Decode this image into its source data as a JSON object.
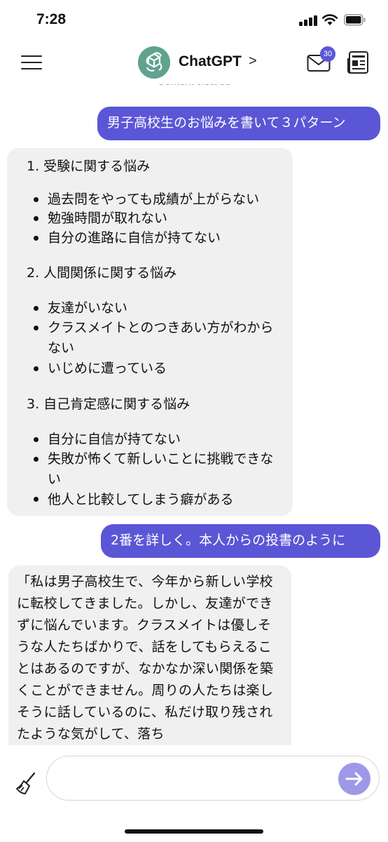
{
  "status": {
    "time": "7:28"
  },
  "header": {
    "title": "ChatGPT",
    "chevron": ">",
    "mail_badge": "30",
    "context_note": "Context cleared"
  },
  "messages": [
    {
      "role": "user",
      "text": "男子高校生のお悩みを書いて３パターン"
    },
    {
      "role": "assistant",
      "sections": [
        {
          "title": "1.  受験に関する悩み",
          "items": [
            "過去問をやっても成績が上がらない",
            "勉強時間が取れない",
            "自分の進路に自信が持てない"
          ]
        },
        {
          "title": "2.  人間関係に関する悩み",
          "items": [
            "友達がいない",
            "クラスメイトとのつきあい方がわからない",
            "いじめに遭っている"
          ]
        },
        {
          "title": "3.  自己肯定感に関する悩み",
          "items": [
            "自分に自信が持てない",
            "失敗が怖くて新しいことに挑戦できない",
            "他人と比較してしまう癖がある"
          ]
        }
      ]
    },
    {
      "role": "user",
      "text": "2番を詳しく。本人からの投書のように"
    },
    {
      "role": "assistant",
      "text": "「私は男子高校生で、今年から新しい学校に転校してきました。しかし、友達ができずに悩んでいます。クラスメイトは優しそうな人たちばかりで、話をしてもらえることはあるのですが、なかなか深い関係を築くことができません。周りの人たちは楽しそうに話しているのに、私だけ取り残されたような気がして、落ち"
    }
  ],
  "input": {
    "placeholder": ""
  },
  "colors": {
    "user_bubble": "#5b56d6",
    "assistant_bubble": "#f0f0f0",
    "send_button": "#9e98e8",
    "logo": "#5fa38f"
  },
  "icons": [
    "menu-icon",
    "chatgpt-logo-icon",
    "mail-icon",
    "news-icon",
    "broom-icon",
    "send-arrow-icon",
    "signal-icon",
    "wifi-icon",
    "battery-icon"
  ]
}
